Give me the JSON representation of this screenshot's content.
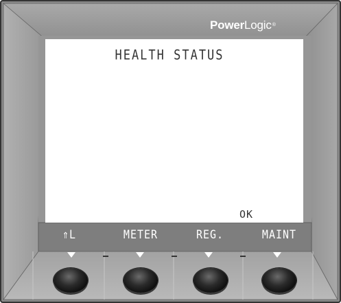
{
  "brand": {
    "power": "Power",
    "logic": "Logic",
    "mark": "®"
  },
  "display": {
    "title": "HEALTH STATUS",
    "status": "OK"
  },
  "softkeys": [
    {
      "label": "⇑L"
    },
    {
      "label": "METER"
    },
    {
      "label": "REG."
    },
    {
      "label": "MAINT"
    }
  ],
  "colors": {
    "bezel_face": "#939393",
    "bezel_edge": "#b8b8b8",
    "screen_bg": "#ffffff",
    "lcd_text": "#333333",
    "button": "#111111"
  }
}
